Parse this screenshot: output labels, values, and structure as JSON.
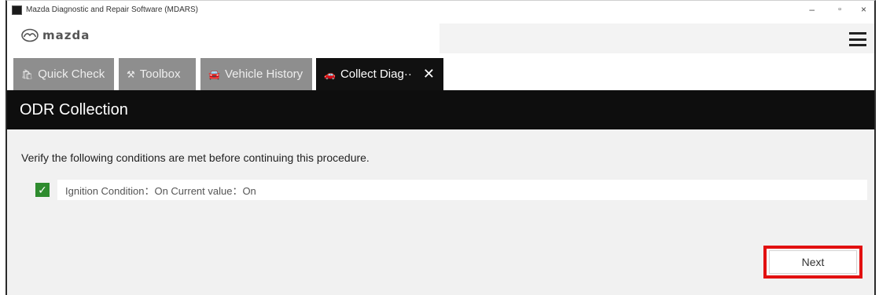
{
  "window": {
    "title": "Mazda Diagnostic and Repair Software (MDARS)",
    "min_glyph": "–",
    "max_glyph": "▫",
    "close_glyph": "×"
  },
  "brand": {
    "wordmark": "mazda",
    "menu_icon": "hamburger-icon"
  },
  "tabs": [
    {
      "label": "Quick Check",
      "icon": "toolbox-bag-icon",
      "icon_glyph": "🛍",
      "active": false
    },
    {
      "label": "Toolbox",
      "icon": "tools-icon",
      "icon_glyph": "⚒",
      "active": false
    },
    {
      "label": "Vehicle History",
      "icon": "car-icon",
      "icon_glyph": "🚘",
      "active": false
    },
    {
      "label": "Collect Diag··",
      "icon": "car-scan-icon",
      "icon_glyph": "🚗",
      "active": true,
      "close_glyph": "✕"
    }
  ],
  "page": {
    "title": "ODR Collection"
  },
  "content": {
    "instruction": "Verify the following conditions are met before continuing this procedure.",
    "conditions": [
      {
        "checked": true,
        "check_glyph": "✓",
        "text": "Ignition Condition：On Current value：On"
      }
    ],
    "next_label": "Next"
  },
  "colors": {
    "tab_inactive": "#8e8e8e",
    "tab_active": "#111111",
    "header_bg": "#0e0e0e",
    "check_green": "#2e8b2e",
    "highlight_red": "#e21010"
  }
}
